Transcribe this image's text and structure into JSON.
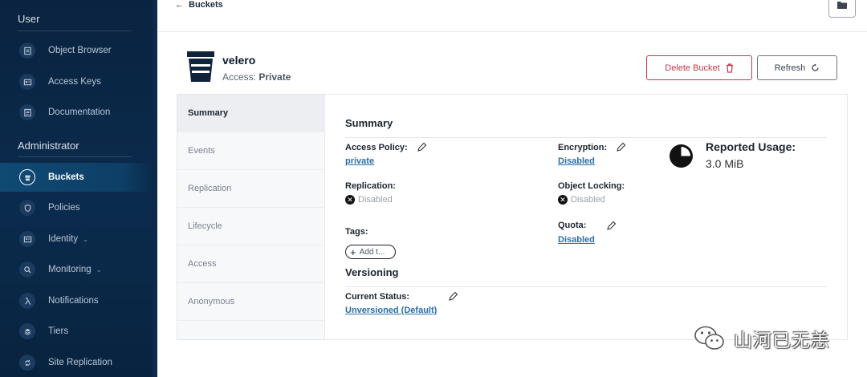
{
  "sidebar": {
    "user_section": "User",
    "admin_section": "Administrator",
    "user_items": [
      {
        "label": "Object Browser",
        "icon": "object-browser-icon"
      },
      {
        "label": "Access Keys",
        "icon": "access-keys-icon"
      },
      {
        "label": "Documentation",
        "icon": "documentation-icon"
      }
    ],
    "admin_items": [
      {
        "label": "Buckets",
        "icon": "buckets-icon",
        "active": true
      },
      {
        "label": "Policies",
        "icon": "policies-icon"
      },
      {
        "label": "Identity",
        "icon": "identity-icon",
        "caret": "⌄"
      },
      {
        "label": "Monitoring",
        "icon": "monitoring-icon",
        "caret": "⌄"
      },
      {
        "label": "Notifications",
        "icon": "lambda-icon"
      },
      {
        "label": "Tiers",
        "icon": "tiers-icon"
      },
      {
        "label": "Site Replication",
        "icon": "site-replication-icon"
      }
    ]
  },
  "topbar": {
    "back_label": "Buckets",
    "back_arrow": "←"
  },
  "bucket": {
    "name": "velero",
    "access_prefix": "Access:",
    "access_value": "Private",
    "delete_label": "Delete Bucket",
    "refresh_label": "Refresh"
  },
  "tabs": [
    "Summary",
    "Events",
    "Replication",
    "Lifecycle",
    "Access",
    "Anonymous"
  ],
  "summary": {
    "title": "Summary",
    "access_policy_label": "Access Policy:",
    "access_policy_value": "private",
    "encryption_label": "Encryption:",
    "encryption_value": "Disabled",
    "replication_label": "Replication:",
    "replication_value": "Disabled",
    "object_locking_label": "Object Locking:",
    "object_locking_value": "Disabled",
    "tags_label": "Tags:",
    "add_tag_label": "Add t...",
    "quota_label": "Quota:",
    "quota_value": "Disabled",
    "usage_title": "Reported Usage:",
    "usage_value": "3.0 MiB",
    "status_icon_glyph": "✕"
  },
  "versioning": {
    "title": "Versioning",
    "current_status_label": "Current Status:",
    "current_status_value": "Unversioned (Default)"
  },
  "watermark": {
    "text": "山河已无恙"
  },
  "colors": {
    "sidebar_bg": "#0b2b4d",
    "active_item": "#0f4a74",
    "danger": "#c0394b",
    "link": "#2a6da8"
  }
}
